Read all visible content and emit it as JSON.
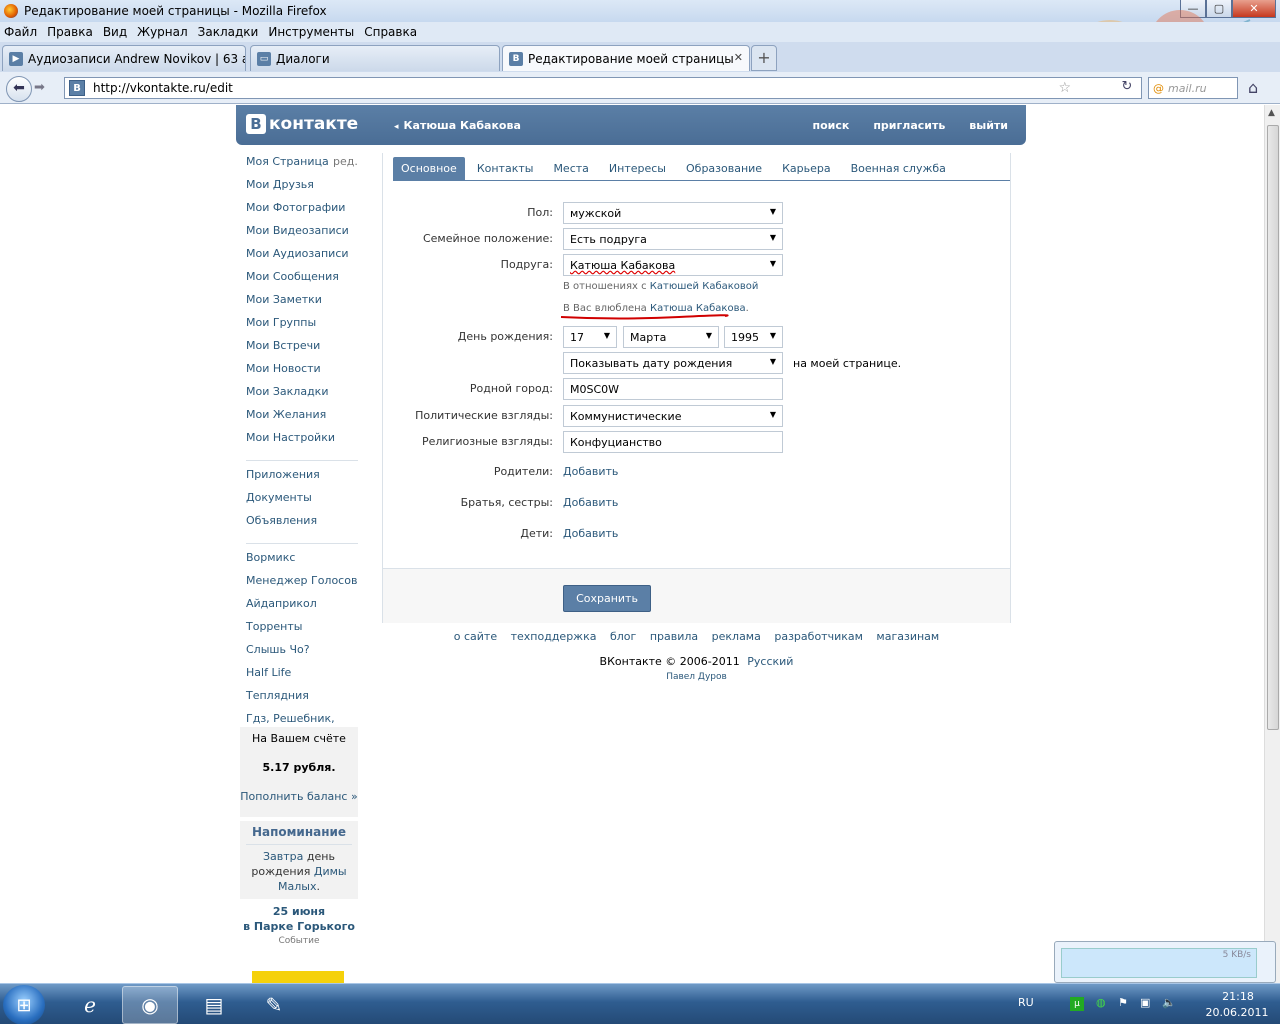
{
  "window": {
    "title": "Редактирование моей страницы - Mozilla Firefox",
    "controls": {
      "minimize": "—",
      "maximize": "▢",
      "close": "✕"
    }
  },
  "menu": [
    "Файл",
    "Правка",
    "Вид",
    "Журнал",
    "Закладки",
    "Инструменты",
    "Справка"
  ],
  "tabs": [
    {
      "label": "Аудиозаписи Andrew Novikov | 63 а...",
      "icon": "play-icon",
      "active": false
    },
    {
      "label": "Диалоги",
      "icon": "chat-icon",
      "active": false
    },
    {
      "label": "Редактирование моей страницы",
      "icon": "vk-icon",
      "active": true
    }
  ],
  "newtab_label": "+",
  "nav": {
    "url": "http://vkontakte.ru/edit",
    "favicon": "B",
    "search_placeholder": "mail.ru"
  },
  "vk": {
    "logo_letter": "B",
    "logo_text": "контакте",
    "user": "Катюша Кабакова",
    "header_links": [
      "поиск",
      "пригласить",
      "выйти"
    ]
  },
  "left_menu": {
    "edit_label": "ред.",
    "group1": [
      "Моя Страница",
      "Мои Друзья",
      "Мои Фотографии",
      "Мои Видеозаписи",
      "Мои Аудиозаписи",
      "Мои Сообщения",
      "Мои Заметки",
      "Мои Группы",
      "Мои Встречи",
      "Мои Новости",
      "Мои Закладки",
      "Мои Желания",
      "Мои Настройки"
    ],
    "group2": [
      "Приложения",
      "Документы",
      "Объявления"
    ],
    "group3": [
      "Вормикс",
      "Менеджер Голосов",
      "Айдаприкол",
      "Торренты",
      "Слышь Чо?",
      "Half Life",
      "Теплядния",
      "Гдз, Решебник,"
    ]
  },
  "balance": {
    "title": "На Вашем счёте",
    "amount": "5.17 рубля.",
    "link": "Пополнить баланс »"
  },
  "reminder": {
    "title": "Напоминание",
    "when": "Завтра",
    "text1": "день",
    "text2": "рождения",
    "name1": "Димы",
    "name2": "Малых",
    "dot": "."
  },
  "event": {
    "date": "25 июня",
    "place": "в Парке Горького",
    "type": "Событие"
  },
  "profile_tabs": [
    "Основное",
    "Контакты",
    "Места",
    "Интересы",
    "Образование",
    "Карьера",
    "Военная служба"
  ],
  "form": {
    "gender": {
      "label": "Пол:",
      "value": "мужской"
    },
    "status": {
      "label": "Семейное положение:",
      "value": "Есть подруга"
    },
    "partner": {
      "label": "Подруга:",
      "value": "Катюша Кабакова"
    },
    "relation_hint": {
      "prefix": "В отношениях с",
      "name": "Катюшей Кабаковой"
    },
    "love_hint": {
      "prefix": "В Вас влюблена",
      "name": "Катюша Кабакова",
      "suffix": "."
    },
    "birthday": {
      "label": "День рождения:",
      "day": "17",
      "month": "Марта",
      "year": "1995"
    },
    "show_birthday": {
      "value": "Показывать дату рождения",
      "suffix": "на моей странице."
    },
    "hometown": {
      "label": "Родной город:",
      "value": "M0SC0W"
    },
    "politics": {
      "label": "Политические взгляды:",
      "value": "Коммунистические"
    },
    "religion": {
      "label": "Религиозные взгляды:",
      "value": "Конфуцианство"
    },
    "parents": {
      "label": "Родители:",
      "link": "Добавить"
    },
    "siblings": {
      "label": "Братья, сестры:",
      "link": "Добавить"
    },
    "children": {
      "label": "Дети:",
      "link": "Добавить"
    },
    "save": "Сохранить"
  },
  "footer": {
    "links": [
      "о сайте",
      "техподдержка",
      "блог",
      "правила",
      "реклама",
      "разработчикам",
      "магазинам"
    ],
    "copyright": "ВКонтакте © 2006-2011",
    "language": "Русский",
    "author": "Павел Дуров"
  },
  "popup": {
    "speed": "5 KB/s"
  },
  "taskbar": {
    "lang": "RU",
    "time": "21:18",
    "date": "20.06.2011"
  },
  "colors": {
    "vk_blue": "#5b7fa6",
    "link": "#2b587a",
    "underline_red": "#d00000"
  }
}
